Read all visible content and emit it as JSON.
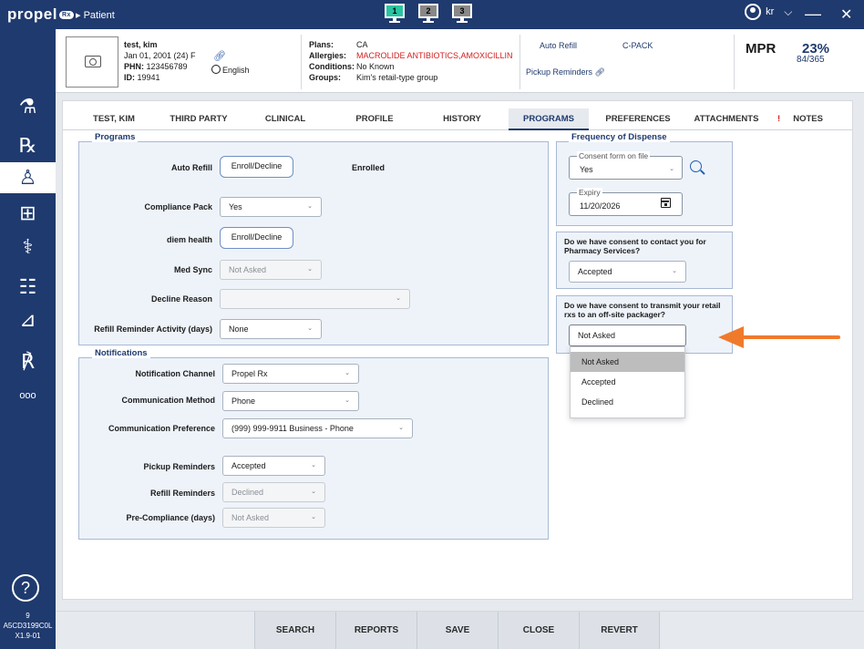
{
  "app": {
    "logo": "propel",
    "logo_badge": "Rx",
    "breadcrumb": "Patient"
  },
  "monitors": [
    "1",
    "2",
    "3"
  ],
  "user": {
    "initials": "kr"
  },
  "window": {
    "minimize": "—",
    "close": "✕"
  },
  "sidebar": {
    "items": [
      {
        "name": "mortar-icon",
        "glyph": "⚗"
      },
      {
        "name": "rx-icon",
        "glyph": "℞"
      },
      {
        "name": "patient-icon",
        "glyph": "♙"
      },
      {
        "name": "pill-box-icon",
        "glyph": "⊞"
      },
      {
        "name": "stethoscope-icon",
        "glyph": "⚕"
      },
      {
        "name": "group-icon",
        "glyph": "☷"
      },
      {
        "name": "scale-icon",
        "glyph": "⊿"
      },
      {
        "name": "prescriber-icon",
        "glyph": "℟"
      },
      {
        "name": "more-icon",
        "glyph": "ooo"
      }
    ],
    "help": "?",
    "footer": [
      "9",
      "A5CD3199C0L",
      "X1.9-01"
    ]
  },
  "patient": {
    "name": "test, kim",
    "dob": "Jan 01, 2001 (24) F",
    "phn_label": "PHN:",
    "phn": "123456789",
    "id_label": "ID:",
    "id": "19941",
    "language": "English",
    "plans_label": "Plans:",
    "plans": "CA",
    "allergies_label": "Allergies:",
    "allergies": "MACROLIDE ANTIBIOTICS,AMOXICILLIN",
    "conditions_label": "Conditions:",
    "conditions": "No Known",
    "groups_label": "Groups:",
    "groups": "Kim's retail-type group",
    "auto_refill": "Auto Refill",
    "cpack": "C-PACK",
    "pickup_reminders": "Pickup Reminders",
    "mpr_label": "MPR",
    "mpr_pct": "23%",
    "mpr_sub": "84/365"
  },
  "tabs": [
    "TEST, KIM",
    "THIRD PARTY",
    "CLINICAL",
    "PROFILE",
    "HISTORY",
    "PROGRAMS",
    "PREFERENCES",
    "ATTACHMENTS",
    "NOTES"
  ],
  "tab_alert": "!",
  "programs": {
    "title": "Programs",
    "auto_refill_label": "Auto Refill",
    "auto_refill_btn": "Enroll/Decline",
    "auto_refill_status": "Enrolled",
    "compliance_label": "Compliance Pack",
    "compliance_value": "Yes",
    "diem_label": "diem health",
    "diem_btn": "Enroll/Decline",
    "medsync_label": "Med Sync",
    "medsync_value": "Not Asked",
    "decline_label": "Decline Reason",
    "decline_value": "",
    "refill_activity_label": "Refill Reminder Activity (days)",
    "refill_activity_value": "None"
  },
  "notifications": {
    "title": "Notifications",
    "channel_label": "Notification Channel",
    "channel_value": "Propel Rx",
    "method_label": "Communication Method",
    "method_value": "Phone",
    "pref_label": "Communication Preference",
    "pref_value": "(999) 999-9911 Business - Phone",
    "pickup_label": "Pickup Reminders",
    "pickup_value": "Accepted",
    "refill_label": "Refill Reminders",
    "refill_value": "Declined",
    "precomp_label": "Pre-Compliance (days)",
    "precomp_value": "Not Asked"
  },
  "frequency": {
    "title": "Frequency of Dispense",
    "consent_label": "Consent form on file",
    "consent_value": "Yes",
    "expiry_label": "Expiry",
    "expiry_value": "11/20/2026"
  },
  "consent_contact": {
    "question": "Do we have consent to contact you for Pharmacy Services?",
    "value": "Accepted"
  },
  "consent_transmit": {
    "question": "Do we have consent to transmit your retail rxs to an off-site packager?",
    "value": "Not Asked",
    "options": [
      "Not Asked",
      "Accepted",
      "Declined"
    ]
  },
  "bottom": [
    "SEARCH",
    "REPORTS",
    "SAVE",
    "CLOSE",
    "REVERT"
  ],
  "colors": {
    "primary": "#1f3a6e",
    "accent_arrow": "#f07a2c",
    "alert": "#d42020"
  }
}
